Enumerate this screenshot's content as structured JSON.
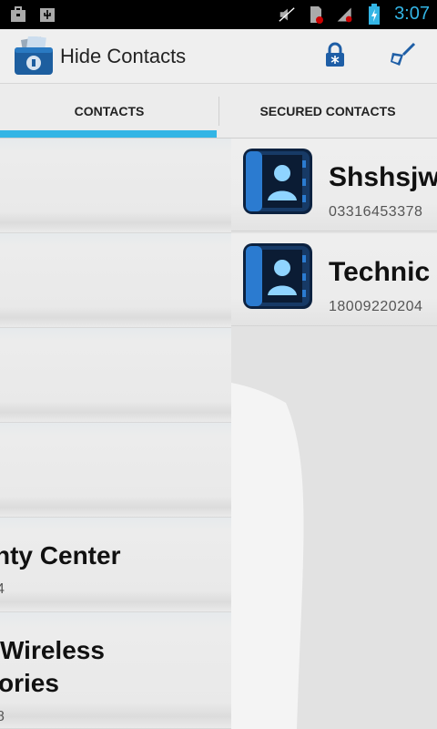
{
  "status_bar": {
    "time": "3:07",
    "left_icons": [
      "briefcase-icon",
      "usb-icon"
    ],
    "right_icons": [
      "mute-icon",
      "sd-card-alert-icon",
      "signal-icon",
      "battery-icon"
    ]
  },
  "app": {
    "title": "Hide Contacts",
    "actions": [
      "lock-icon",
      "broom-icon"
    ]
  },
  "tabs": {
    "contacts": "CONTACTS",
    "secured": "SECURED CONTACTS",
    "active": "contacts",
    "accent": "#33b5e5"
  },
  "contacts": [
    {
      "name": "",
      "number": ""
    },
    {
      "name": "",
      "number": ""
    },
    {
      "name": "",
      "number": ""
    },
    {
      "name": "",
      "number": ""
    },
    {
      "name": "nty Center",
      "number": "4"
    },
    {
      "name": "Wireless",
      "name2": "ories",
      "number": "8"
    }
  ],
  "secured_contacts": [
    {
      "name": "Shshsjw",
      "number": "03316453378"
    },
    {
      "name": "Technic",
      "number": "18009220204"
    }
  ]
}
